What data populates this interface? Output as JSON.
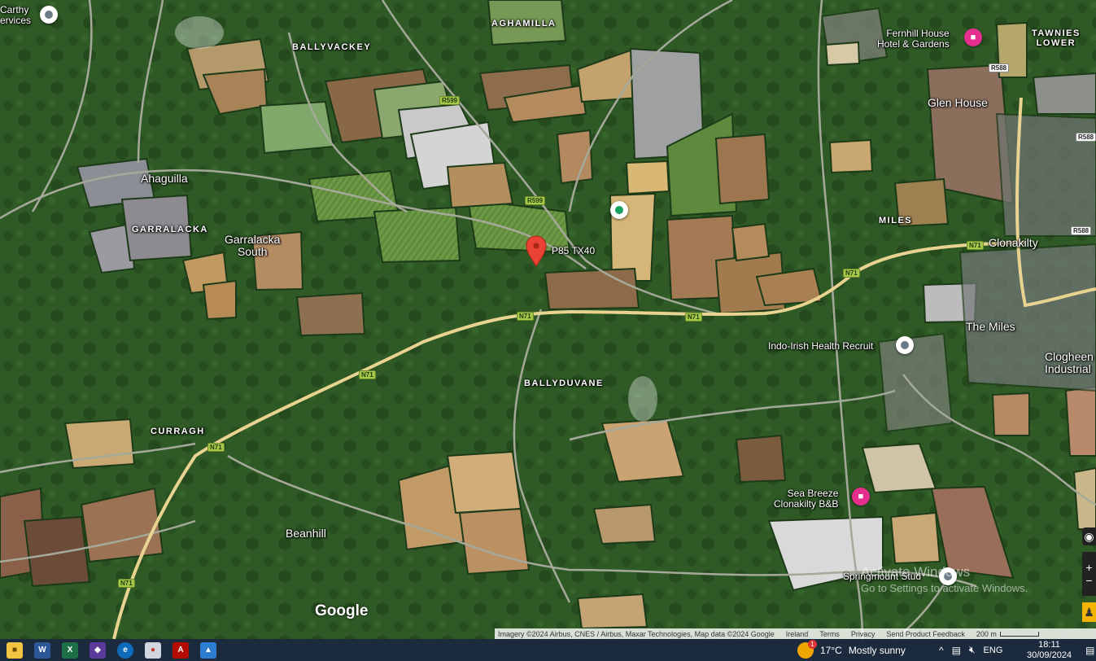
{
  "map": {
    "areas": [
      {
        "id": "aghamilla",
        "text": "AGHAMILLA"
      },
      {
        "id": "ballyvackey",
        "text": "BALLYVACKEY"
      },
      {
        "id": "garralacka",
        "text": "GARRALACKA"
      },
      {
        "id": "miles",
        "text": "MILES"
      },
      {
        "id": "ballyduvane",
        "text": "BALLYDUVANE"
      },
      {
        "id": "curragh",
        "text": "CURRAGH"
      },
      {
        "id": "tawnies",
        "text": "TAWNIES\nLOWER"
      }
    ],
    "towns": [
      {
        "id": "ahaguilla",
        "text": "Ahaguilla"
      },
      {
        "id": "garralacka-south",
        "text": "Garralacka\nSouth"
      },
      {
        "id": "glen-house",
        "text": "Glen House"
      },
      {
        "id": "clonakilty",
        "text": "Clonakilty"
      },
      {
        "id": "the-miles",
        "text": "The Miles"
      },
      {
        "id": "beanhill",
        "text": "Beanhill"
      },
      {
        "id": "clogheen",
        "text": "Clogheen\nIndustrial"
      },
      {
        "id": "carthy",
        "text": "Carthy\nervices"
      }
    ],
    "pois": [
      {
        "id": "fernhill",
        "text": "Fernhill House\nHotel & Gardens",
        "icon": "hotel-icon"
      },
      {
        "id": "indo-irish",
        "text": "Indo-Irish Health Recruit",
        "icon": "place-icon"
      },
      {
        "id": "sea-breeze",
        "text": "Sea Breeze\nClonakilty B&B",
        "icon": "hotel-icon"
      },
      {
        "id": "springmount",
        "text": "Springmount Stud",
        "icon": "place-icon"
      },
      {
        "id": "pin-label",
        "text": "P85 TX40"
      }
    ],
    "shields": [
      "R599",
      "R599",
      "N71",
      "N71",
      "N71",
      "N71",
      "N71",
      "N71",
      "R588",
      "R588",
      "R588"
    ],
    "google_logo": "Google",
    "attribution": [
      "Imagery ©2024 Airbus, CNES / Airbus, Maxar Technologies, Map data ©2024 Google",
      "Ireland",
      "Terms",
      "Privacy",
      "Send Product Feedback",
      "200 m"
    ],
    "watermark": {
      "line1": "Activate Windows",
      "line2": "Go to Settings to activate Windows."
    }
  },
  "taskbar": {
    "apps": [
      "File Explorer",
      "Word",
      "Excel",
      "Visual Studio",
      "Edge",
      "Paint",
      "Acrobat",
      "Photos"
    ],
    "weather": {
      "temp": "17°C",
      "desc": "Mostly sunny",
      "badge": "1"
    },
    "lang": "ENG",
    "time": "18:11",
    "date": "30/09/2024"
  },
  "colors": {
    "road_main": "#e8d390",
    "road_minor": "#a5a99a",
    "pin": "#ea4335",
    "taskbar": "#1c2a3e"
  }
}
